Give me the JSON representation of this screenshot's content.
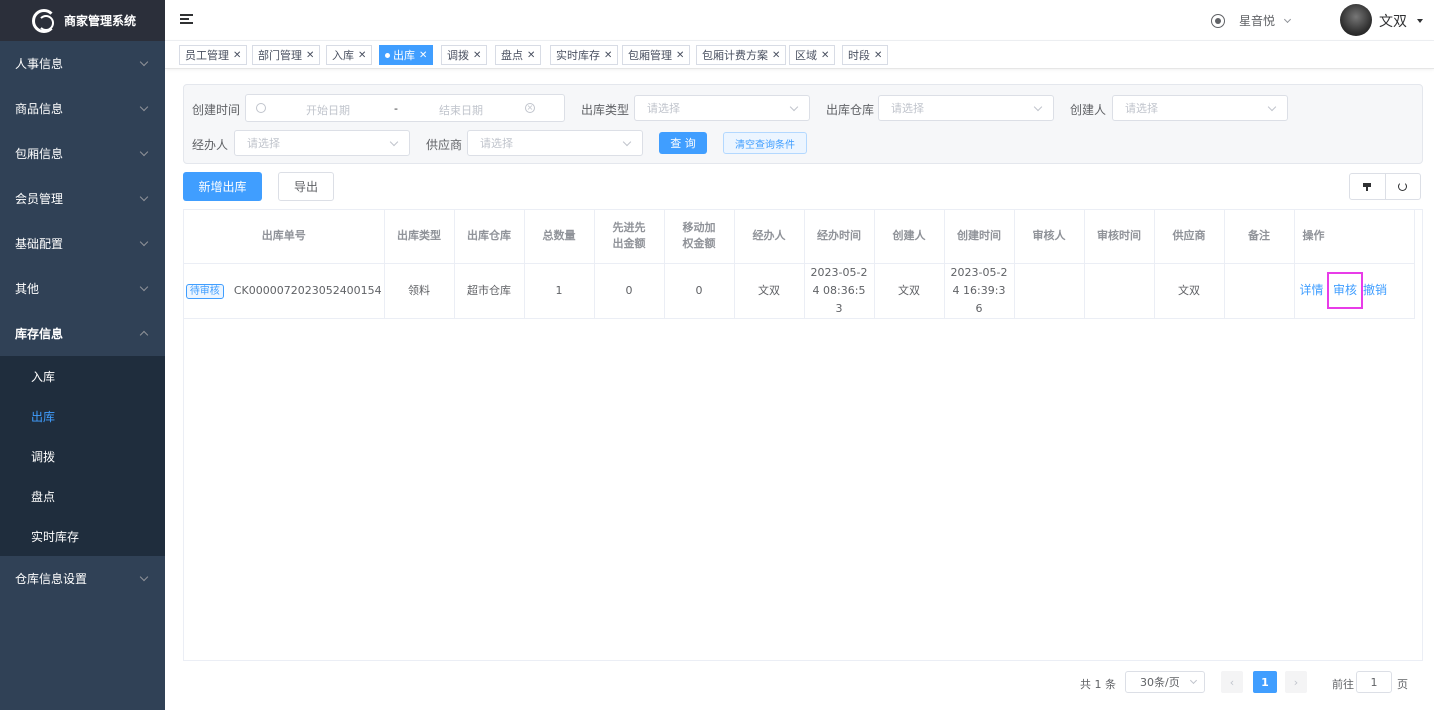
{
  "app": {
    "title": "商家管理系统"
  },
  "sidebar": {
    "items": [
      {
        "label": "人事信息"
      },
      {
        "label": "商品信息"
      },
      {
        "label": "包厢信息"
      },
      {
        "label": "会员管理"
      },
      {
        "label": "基础配置"
      },
      {
        "label": "其他"
      },
      {
        "label": "库存信息",
        "expanded": true
      },
      {
        "label": "仓库信息设置"
      }
    ],
    "sub_items": [
      {
        "label": "入库"
      },
      {
        "label": "出库",
        "active": true
      },
      {
        "label": "调拨"
      },
      {
        "label": "盘点"
      },
      {
        "label": "实时库存"
      }
    ]
  },
  "header": {
    "tenant": "星音悦",
    "username": "文双"
  },
  "tags": [
    {
      "label": "员工管理"
    },
    {
      "label": "部门管理"
    },
    {
      "label": "入库"
    },
    {
      "label": "出库",
      "active": true
    },
    {
      "label": "调拨"
    },
    {
      "label": "盘点"
    },
    {
      "label": "实时库存"
    },
    {
      "label": "包厢管理"
    },
    {
      "label": "包厢计费方案"
    },
    {
      "label": "区域"
    },
    {
      "label": "时段"
    }
  ],
  "search": {
    "create_time_label": "创建时间",
    "start_placeholder": "开始日期",
    "range_separator": "-",
    "end_placeholder": "结束日期",
    "type_label": "出库类型",
    "warehouse_label": "出库仓库",
    "creator_label": "创建人",
    "handler_label": "经办人",
    "supplier_label": "供应商",
    "select_placeholder": "请选择",
    "query_button": "查 询",
    "reset_button": "清空查询条件"
  },
  "toolbar": {
    "add_button": "新增出库",
    "export_button": "导出"
  },
  "table": {
    "columns": [
      "出库单号",
      "出库类型",
      "出库仓库",
      "总数量",
      "先进先出金额",
      "移动加权金额",
      "经办人",
      "经办时间",
      "创建人",
      "创建时间",
      "审核人",
      "审核时间",
      "供应商",
      "备注",
      "操作"
    ],
    "rows": [
      {
        "status": "待审核",
        "order_no": "CK0000072023052400154",
        "type": "领料",
        "warehouse": "超市仓库",
        "quantity": "1",
        "fifo_amount": "0",
        "mwa_amount": "0",
        "handler": "文双",
        "handle_time": "2023-05-24 08:36:53",
        "creator": "文双",
        "create_time": "2023-05-24 16:39:36",
        "reviewer": "",
        "review_time": "",
        "supplier": "文双",
        "remark": "",
        "actions": {
          "detail": "详情",
          "review": "审核",
          "revoke": "撤销"
        }
      }
    ]
  },
  "pagination": {
    "total_text": "共 1 条",
    "page_size": "30条/页",
    "current_page": "1",
    "goto_label": "前往",
    "goto_value": "1",
    "page_unit": "页"
  },
  "colors": {
    "primary": "#409eff",
    "sidebar_bg": "#304156",
    "highlight": "#e83ce8"
  }
}
